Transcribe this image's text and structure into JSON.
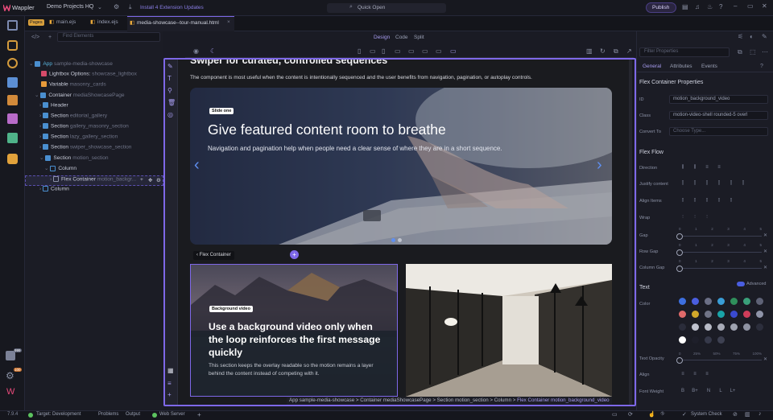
{
  "topbar": {
    "app_name": "Wappler",
    "project": "Demo Projects HQ",
    "extension_updates": "Install 4 Extension Updates",
    "quick_open": "Quick Open",
    "publish": "Publish"
  },
  "tabs": [
    {
      "label": "Pages"
    },
    {
      "label": "main.ejs"
    },
    {
      "label": "index.ejs"
    },
    {
      "label": "media-showcase--tour-manual.html"
    }
  ],
  "view_modes": {
    "design": "Design",
    "code": "Code",
    "split": "Split"
  },
  "navigator": {
    "search_placeholder": "Find Elements",
    "filter_placeholder": "Filter Properties"
  },
  "tree": [
    {
      "type": "App",
      "name": "sample-media-showcase"
    },
    {
      "type": "Lightbox Options:",
      "name": "showcase_lightbox"
    },
    {
      "type": "Variable",
      "name": "masonry_cards"
    },
    {
      "type": "Container",
      "name": "mediaShowcasePage"
    },
    {
      "type": "Header",
      "name": ""
    },
    {
      "type": "Section",
      "name": "editorial_gallery"
    },
    {
      "type": "Section",
      "name": "gallery_masonry_section"
    },
    {
      "type": "Section",
      "name": "lazy_gallery_section"
    },
    {
      "type": "Section",
      "name": "swiper_showcase_section"
    },
    {
      "type": "Section",
      "name": "motion_section"
    },
    {
      "type": "Column",
      "name": ""
    },
    {
      "type": "Flex Container",
      "name": "motion_backgr..."
    },
    {
      "type": "Column",
      "name": ""
    }
  ],
  "canvas": {
    "partial_heading": "Swiper for curated, controlled sequences",
    "intro": "The component is most useful when the content is intentionally sequenced and the user benefits from navigation, pagination, or autoplay controls.",
    "slide_badge": "Slide one",
    "slide_title": "Give featured content room to breathe",
    "slide_text": "Navigation and pagination help when people need a clear sense of where they are in a short sequence.",
    "flex_tag": "Flex Container",
    "bg_badge": "Background video",
    "bg_title": "Use a background video only when the loop reinforces the first message quickly",
    "bg_text": "This section keeps the overlay readable so the motion remains a layer behind the content instead of competing with it.",
    "breadcrumb": "App sample-media-showcase > Container mediaShowcasePage > Section motion_section > Column > ",
    "breadcrumb_current": "Flex Container motion_background_video"
  },
  "properties": {
    "tabs": [
      "General",
      "Attributes",
      "Events"
    ],
    "title": "Flex Container Properties",
    "id_label": "ID",
    "id_value": "motion_background_video",
    "class_label": "Class",
    "class_value": "motion-video-shell rounded-5 overl",
    "convert_label": "Convert To",
    "convert_placeholder": "Choose Type...",
    "flex_flow": "Flex Flow",
    "direction": "Direction",
    "justify": "Justify content",
    "align_items": "Align Items",
    "wrap": "Wrap",
    "gap": "Gap",
    "row_gap": "Row Gap",
    "column_gap": "Column Gap",
    "gap_ticks": [
      "0",
      "1",
      "2",
      "3",
      "4",
      "5"
    ],
    "text_section": "Text",
    "advanced": "Advanced",
    "color": "Color",
    "text_opacity": "Text Opacity",
    "opacity_ticks": [
      "0",
      "25%",
      "50%",
      "75%",
      "100%"
    ],
    "align": "Align",
    "font_weight": "Font Weight",
    "font_weights": [
      "B",
      "B+",
      "N",
      "L",
      "L+"
    ]
  },
  "colors": {
    "accent": "#7e68e8",
    "swatches": [
      "#3d6fe0",
      "#4a5ee0",
      "#6b6f86",
      "#3a9dd6",
      "#2f8f5b",
      "#3aa07a",
      "#5e6276",
      "#e06a6a",
      "#d1a72a",
      "#707487",
      "#19a3a8",
      "#3a4ad0",
      "#cf3d5a",
      "#8f94a8",
      "#2a2c3a",
      "#c0c3cf",
      "#b7bac6",
      "#a8abb8",
      "#9ea2b0",
      "#8e92a2",
      "#2c2e3c",
      "#ffffff",
      "#1e1f2a",
      "#36394a",
      "#3e4152"
    ]
  },
  "statusbar": {
    "version": "7.9.4",
    "target": "Target: Development",
    "problems": "Problems",
    "output": "Output",
    "web_server": "Web Server",
    "system_check": "System Check"
  },
  "badges": {
    "notif1": "999",
    "notif2": "100"
  }
}
